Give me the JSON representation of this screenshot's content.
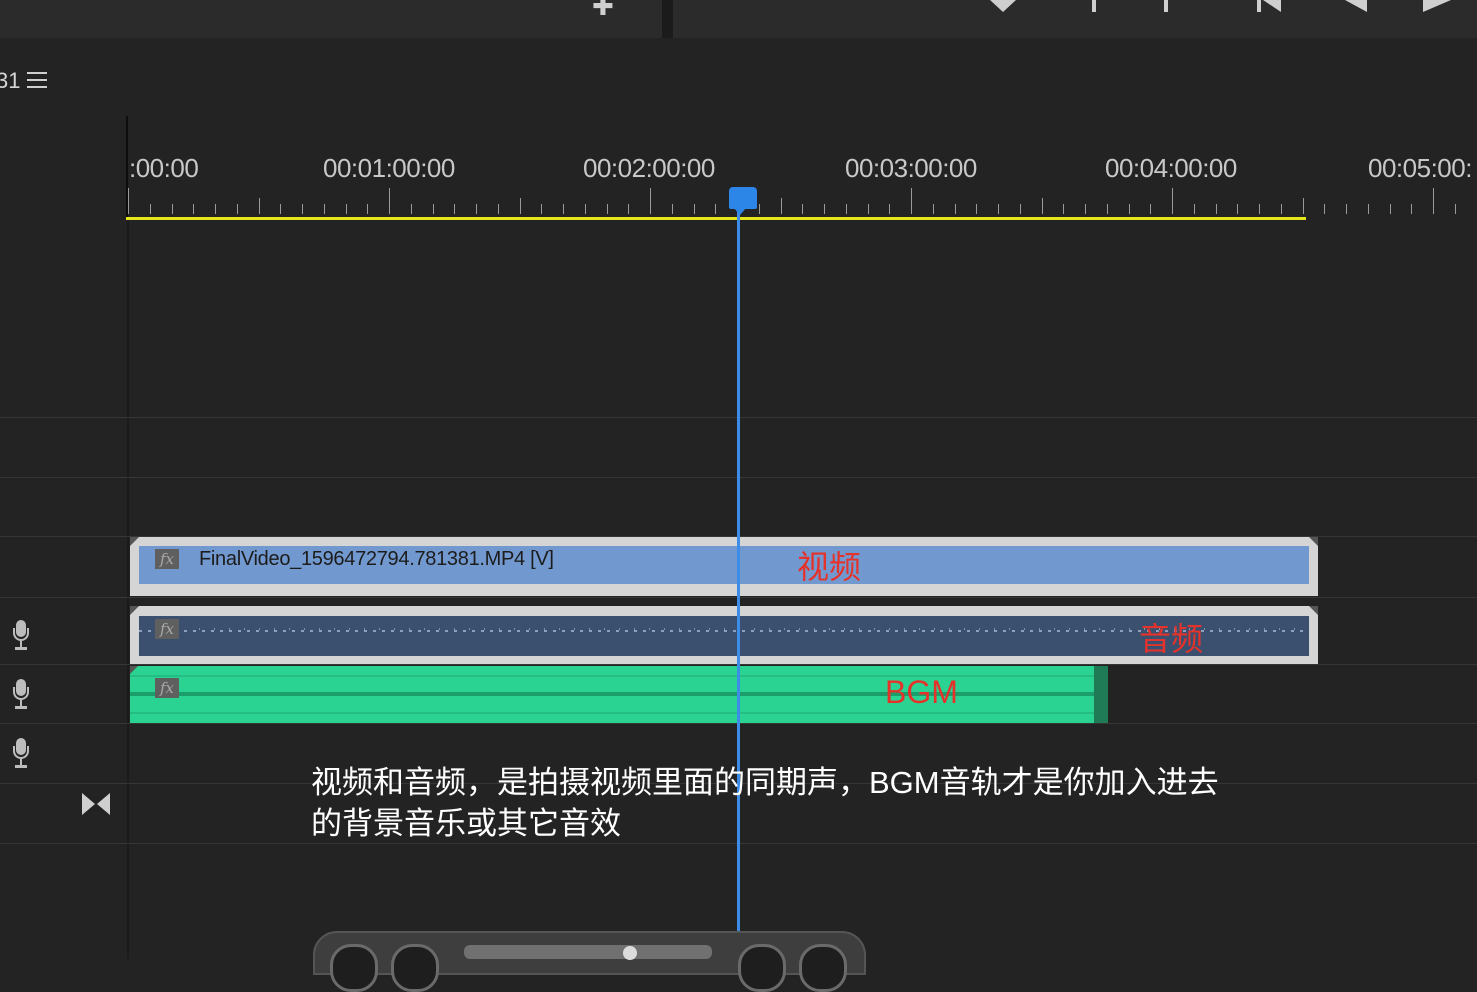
{
  "sequence": {
    "name_fragment": "31"
  },
  "ruler": {
    "timecodes": [
      ":00:00",
      "00:01:00:00",
      "00:02:00:00",
      "00:03:00:00",
      "00:04:00:00",
      "00:05:00:"
    ]
  },
  "playhead": {
    "time": "00:02:20:00"
  },
  "tracks": {
    "video_clip": {
      "fx": "fx",
      "name": "FinalVideo_1596472794.781381.MP4 [V]"
    },
    "audio_clip": {
      "fx": "fx"
    },
    "bgm_clip": {
      "fx": "fx"
    }
  },
  "annotations": {
    "video": "视频",
    "audio": "音频",
    "bgm": "BGM",
    "caption_line1": "视频和音频，是拍摄视频里面的同期声，BGM音轨才是你加入进去",
    "caption_line2": "的背景音乐或其它音效"
  },
  "colors": {
    "playhead": "#2b86e8",
    "work_area": "#e7e61a",
    "video_clip": "#7299cf",
    "audio_clip": "#3b506e",
    "bgm_clip": "#2bd393",
    "annotation_red": "#e5322a"
  },
  "icons": [
    "add-marker-icon",
    "marker-icon",
    "in-point-icon",
    "out-point-icon",
    "go-to-in-icon",
    "step-back-icon",
    "play-icon",
    "menu-icon",
    "microphone-icon",
    "transition-icon"
  ]
}
